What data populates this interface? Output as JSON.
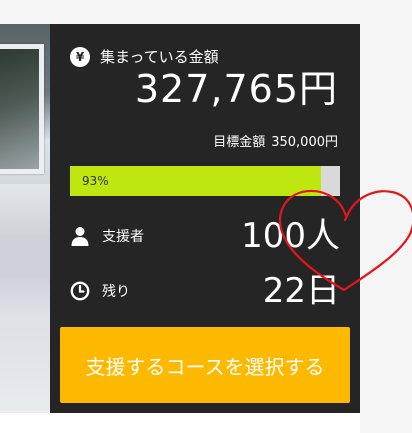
{
  "funding": {
    "raised_label": "集まっている金額",
    "raised_amount": "327,765円",
    "target_label": "目標金額",
    "target_amount": "350,000円",
    "progress_text": "93%",
    "progress_value": 0.93
  },
  "stats": {
    "supporters_label": "支援者",
    "supporters_value": "100人",
    "remaining_label": "残り",
    "remaining_value": "22日"
  },
  "cta": {
    "label": "支援するコースを選択する"
  },
  "icons": {
    "yen": "yen-circle-icon",
    "supporters": "person-icon",
    "remaining": "clock-icon"
  },
  "colors": {
    "panel_bg": "#252525",
    "progress_fill": "#bde70f",
    "progress_track": "#d9d9d9",
    "cta_bg": "#fdb900",
    "annotation": "#e3161b"
  }
}
